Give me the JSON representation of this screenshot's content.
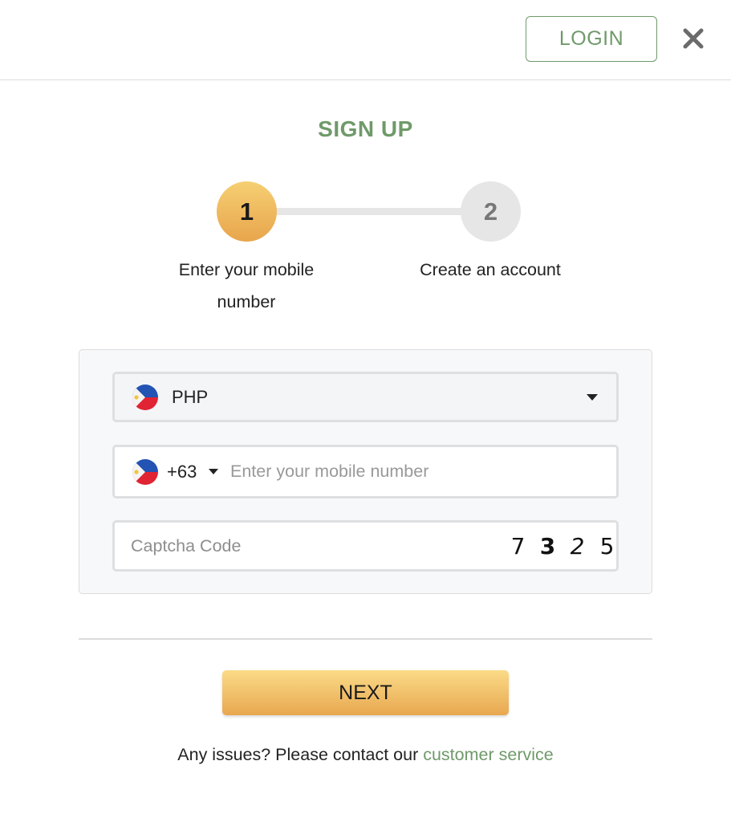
{
  "header": {
    "login_label": "LOGIN",
    "close_icon": "close-icon"
  },
  "signup": {
    "title": "SIGN UP",
    "steps": [
      {
        "number": "1",
        "label": "Enter your mobile number",
        "state": "active"
      },
      {
        "number": "2",
        "label": "Create an account",
        "state": "inactive"
      }
    ]
  },
  "form": {
    "currency": {
      "value": "PHP",
      "flag_icon": "philippines-flag-icon",
      "dropdown_icon": "caret-down-icon"
    },
    "phone": {
      "country_code": "+63",
      "placeholder": "Enter your mobile number",
      "value": "",
      "flag_icon": "philippines-flag-icon"
    },
    "captcha": {
      "placeholder": "Captcha Code",
      "value": "",
      "digits": [
        "7",
        "3",
        "2",
        "5"
      ]
    }
  },
  "actions": {
    "next_label": "NEXT"
  },
  "help": {
    "text": "Any issues? Please contact our ",
    "link_text": "customer service"
  },
  "colors": {
    "accent_green": "#6f9a6a",
    "button_gold_top": "#fbdb88",
    "button_gold_bottom": "#e8a74f"
  }
}
